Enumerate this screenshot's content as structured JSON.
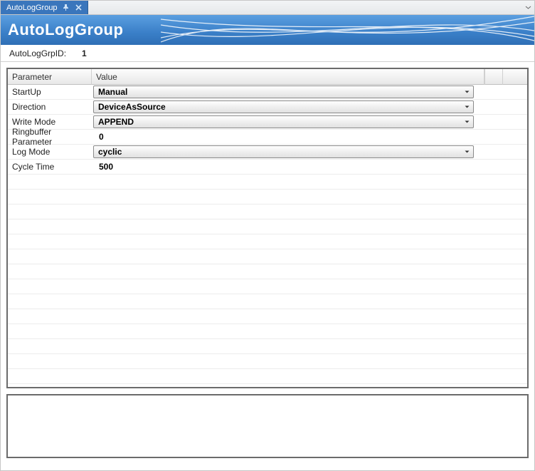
{
  "tab": {
    "label": "AutoLogGroup"
  },
  "banner": {
    "title": "AutoLogGroup"
  },
  "idbar": {
    "label": "AutoLogGrpID:",
    "value": "1"
  },
  "grid": {
    "headers": {
      "param": "Parameter",
      "value": "Value"
    },
    "rows": [
      {
        "param": "StartUp",
        "value": "Manual",
        "type": "select"
      },
      {
        "param": "Direction",
        "value": "DeviceAsSource",
        "type": "select"
      },
      {
        "param": "Write Mode",
        "value": "APPEND",
        "type": "select"
      },
      {
        "param": "Ringbuffer Parameter",
        "value": "0",
        "type": "text"
      },
      {
        "param": "Log Mode",
        "value": "cyclic",
        "type": "select"
      },
      {
        "param": "Cycle Time",
        "value": "500",
        "type": "text"
      }
    ]
  }
}
